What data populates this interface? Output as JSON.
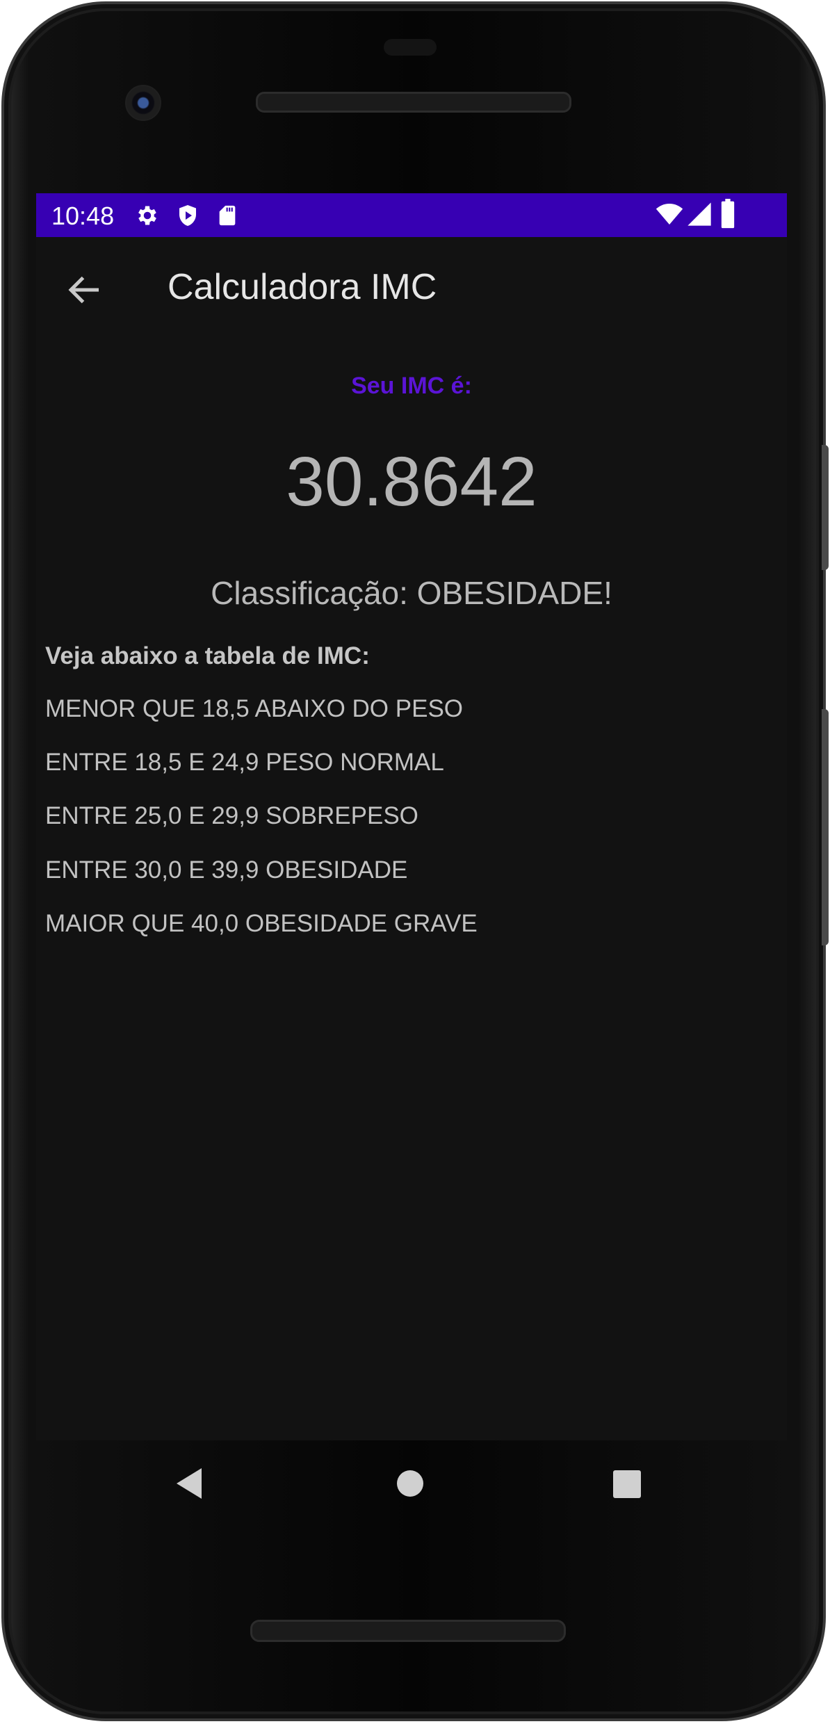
{
  "status_bar": {
    "time": "10:48",
    "left_icons": [
      "gear-icon",
      "shield-play-icon",
      "sd-card-icon"
    ],
    "right_icons": [
      "wifi-icon",
      "signal-icon",
      "battery-icon"
    ],
    "color": "#3700b3"
  },
  "toolbar": {
    "title": "Calculadora IMC",
    "back_icon": "arrow-left-icon"
  },
  "result": {
    "label": "Seu IMC é:",
    "label_color": "#5b14d6",
    "value": "30.8642",
    "classification": "Classificação: OBESIDADE!"
  },
  "imc_table": {
    "title": "Veja abaixo a tabela de IMC:",
    "rows": [
      "MENOR QUE 18,5 ABAIXO DO PESO",
      "ENTRE 18,5 E 24,9 PESO NORMAL",
      "ENTRE 25,0 E 29,9 SOBREPESO",
      "ENTRE 30,0 E 39,9 OBESIDADE",
      "MAIOR QUE 40,0 OBESIDADE GRAVE"
    ]
  },
  "navigation": {
    "buttons": [
      "back-triangle-icon",
      "home-circle-icon",
      "recents-square-icon"
    ]
  }
}
